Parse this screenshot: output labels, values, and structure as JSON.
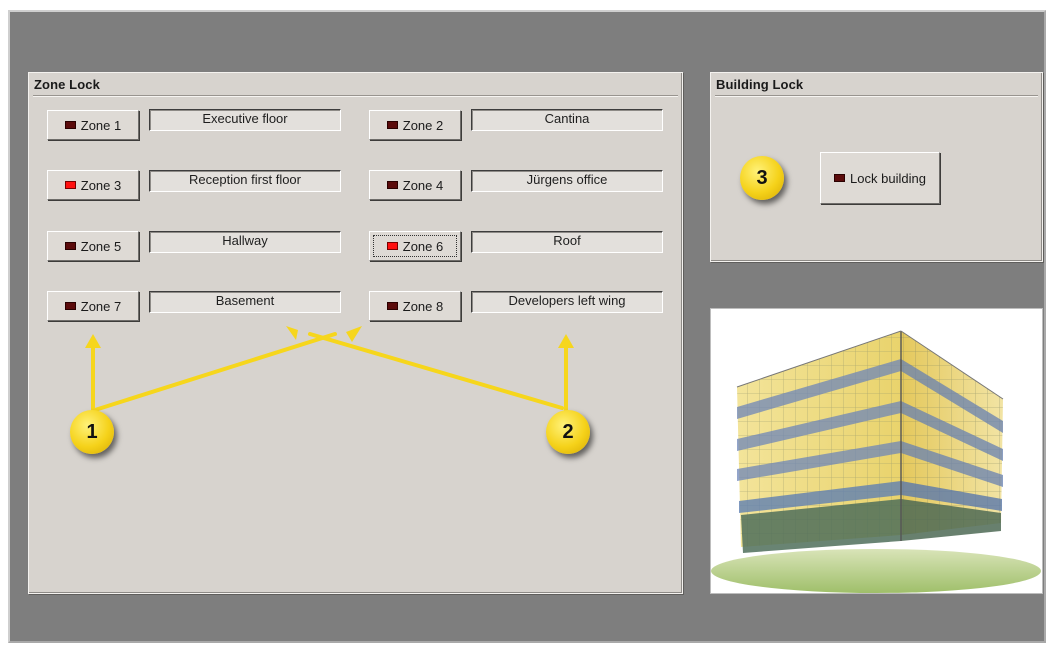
{
  "zone_lock": {
    "title": "Zone Lock",
    "zones": [
      {
        "button": "Zone 1",
        "name": "Executive floor",
        "led": "off"
      },
      {
        "button": "Zone 2",
        "name": "Cantina",
        "led": "off"
      },
      {
        "button": "Zone 3",
        "name": "Reception first floor",
        "led": "on"
      },
      {
        "button": "Zone 4",
        "name": "Jürgens office",
        "led": "off"
      },
      {
        "button": "Zone 5",
        "name": "Hallway",
        "led": "off"
      },
      {
        "button": "Zone 6",
        "name": "Roof",
        "led": "on"
      },
      {
        "button": "Zone 7",
        "name": "Basement",
        "led": "off"
      },
      {
        "button": "Zone 8",
        "name": "Developers left wing",
        "led": "off"
      }
    ]
  },
  "building_lock": {
    "title": "Building Lock",
    "button": "Lock building",
    "led": "off"
  },
  "callouts": [
    "1",
    "2",
    "3"
  ],
  "colors": {
    "panel": "#d7d3ce",
    "window": "#7e7e7e",
    "led_off": "#5b0b0b",
    "led_on": "#ff1010",
    "callout": "#f5d21a"
  },
  "image": {
    "icon": "building-image"
  }
}
